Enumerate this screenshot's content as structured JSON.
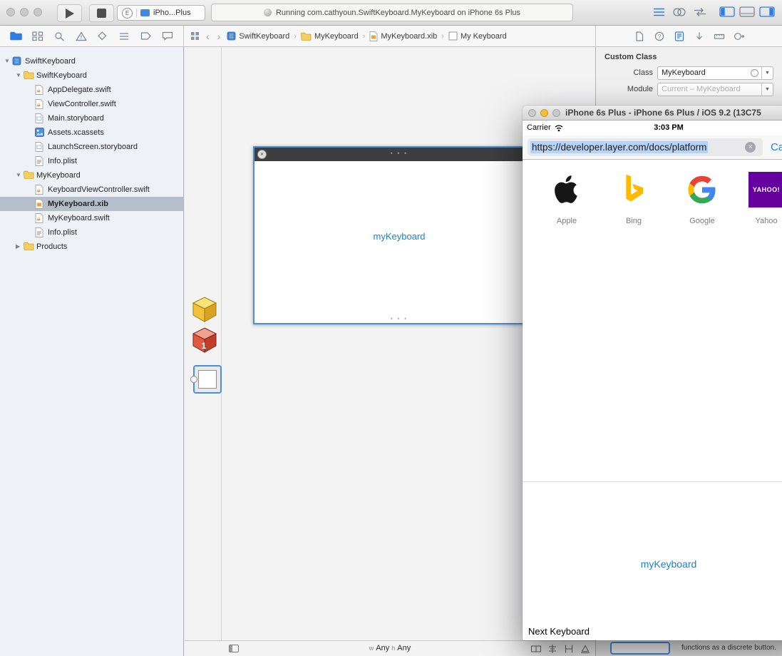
{
  "colors": {
    "accent": "#2f7de1",
    "selection": "#b4bfca",
    "ios_blue": "#157efb",
    "canvas_label_blue": "#1a7fd4"
  },
  "toolbar": {
    "scheme": {
      "badge": "E",
      "device": "iPho...Plus"
    },
    "status": "Running com.cathyoun.SwiftKeyboard.MyKeyboard on iPhone 6s Plus",
    "editor_buttons": [
      "standard-editor",
      "assistant-editor",
      "version-editor"
    ],
    "panel_buttons": [
      "navigator-panel",
      "debug-panel",
      "utilities-panel"
    ]
  },
  "navbar": {
    "navigators": [
      "project",
      "symbol",
      "search",
      "issue",
      "test",
      "debug",
      "breakpoint",
      "report"
    ],
    "active_navigator": 0,
    "back_glyph": "‹",
    "forward_glyph": "›",
    "breadcrumbs": [
      {
        "label": "SwiftKeyboard",
        "type": "project"
      },
      {
        "label": "MyKeyboard",
        "type": "folder"
      },
      {
        "label": "MyKeyboard.xib",
        "type": "xib"
      },
      {
        "label": "My Keyboard",
        "type": "view"
      }
    ],
    "inspectors": [
      "file",
      "quick-help",
      "identity",
      "attributes",
      "size",
      "connections"
    ],
    "active_inspector": 2
  },
  "sidebar": {
    "items": [
      {
        "label": "SwiftKeyboard",
        "type": "project",
        "level": 0,
        "disclosure": "open"
      },
      {
        "label": "SwiftKeyboard",
        "type": "folder",
        "level": 1,
        "disclosure": "open"
      },
      {
        "label": "AppDelegate.swift",
        "type": "swift",
        "level": 2
      },
      {
        "label": "ViewController.swift",
        "type": "swift",
        "level": 2
      },
      {
        "label": "Main.storyboard",
        "type": "storyboard",
        "level": 2
      },
      {
        "label": "Assets.xcassets",
        "type": "assets",
        "level": 2
      },
      {
        "label": "LaunchScreen.storyboard",
        "type": "storyboard",
        "level": 2
      },
      {
        "label": "Info.plist",
        "type": "plist",
        "level": 2
      },
      {
        "label": "MyKeyboard",
        "type": "folder",
        "level": 1,
        "disclosure": "open"
      },
      {
        "label": "KeyboardViewController.swift",
        "type": "swift",
        "level": 2
      },
      {
        "label": "MyKeyboard.xib",
        "type": "xib",
        "level": 2,
        "selected": true
      },
      {
        "label": "MyKeyboard.swift",
        "type": "swift",
        "level": 2
      },
      {
        "label": "Info.plist",
        "type": "plist",
        "level": 2
      },
      {
        "label": "Products",
        "type": "folder",
        "level": 1,
        "disclosure": "closed"
      }
    ]
  },
  "inspector": {
    "title": "Custom Class",
    "class_label": "Class",
    "class_value": "MyKeyboard",
    "module_label": "Module",
    "module_value": "Current – MyKeyboard"
  },
  "canvas": {
    "view_label": "myKeyboard",
    "header_dots": "• • •",
    "footer_dots": "• • •",
    "close_glyph": "×",
    "size": {
      "w_label": "w",
      "w_value": "Any",
      "h_label": "h",
      "h_value": "Any"
    },
    "ib_buttons": [
      "stack",
      "align",
      "pin",
      "resolve"
    ]
  },
  "library": {
    "description": "functions as a discrete button."
  },
  "simulator": {
    "title": "iPhone 6s Plus - iPhone 6s Plus / iOS 9.2 (13C75",
    "carrier": "Carrier",
    "time": "3:03 PM",
    "url": "https://developer.layer.com/docs/platform",
    "clear_glyph": "×",
    "cancel_label": "Cancel",
    "favorites": [
      {
        "label": "Apple",
        "icon": "apple-logo"
      },
      {
        "label": "Bing",
        "icon": "bing-logo"
      },
      {
        "label": "Google",
        "icon": "google-logo"
      },
      {
        "label": "Yahoo",
        "icon": "yahoo-logo"
      }
    ],
    "keyboard_label": "myKeyboard",
    "next_keyboard_label": "Next Keyboard"
  }
}
